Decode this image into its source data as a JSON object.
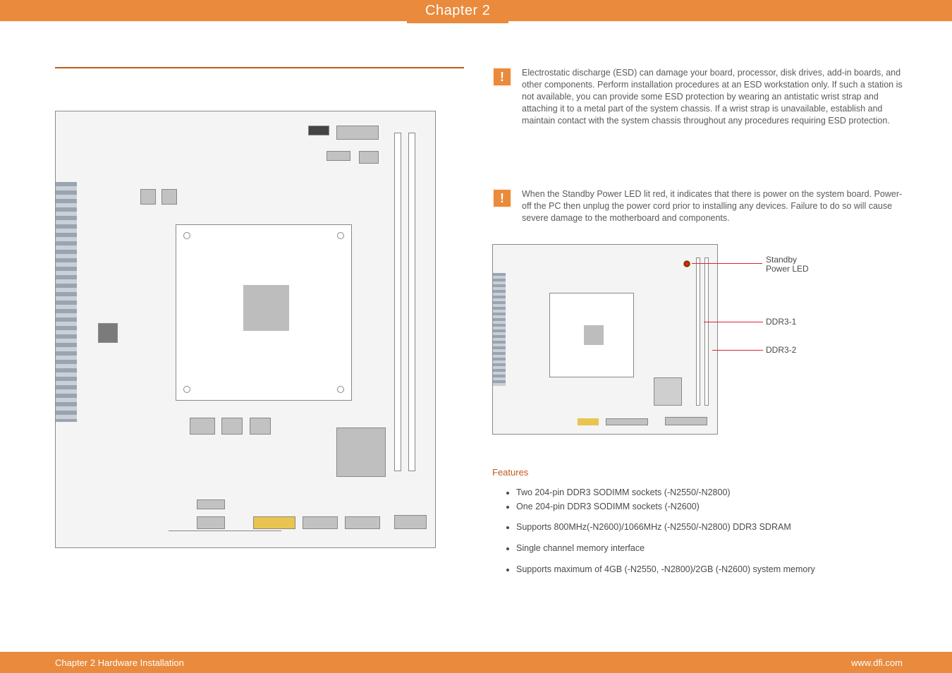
{
  "header": {
    "chapter_tab": "Chapter 2"
  },
  "important": {
    "esd": "Electrostatic discharge (ESD) can damage your board, processor, disk drives, add-in boards, and other components. Perform installation procedures at an ESD workstation only. If such a station is not available, you can provide some ESD protection by wearing an antistatic wrist strap and attaching it to a metal part of the system chassis. If a wrist strap is unavailable, establish and maintain contact with the system chassis throughout any procedures requiring ESD protection.",
    "standby": "When the Standby Power LED lit red, it indicates that there is power on the system board. Power-off the PC then unplug the power cord prior to installing any devices. Failure to do so will cause severe damage to the motherboard and components."
  },
  "board_labels": {
    "standby_led_line1": "Standby",
    "standby_led_line2": "Power LED",
    "ddr3_1": "DDR3-1",
    "ddr3_2": "DDR3-2"
  },
  "features": {
    "title": "Features",
    "items": [
      "Two 204-pin DDR3 SODIMM sockets (-N2550/-N2800)",
      "One 204-pin DDR3 SODIMM sockets (-N2600)",
      "Supports 800MHz(-N2600)/1066MHz (-N2550/-N2800) DDR3 SDRAM",
      "Single channel memory interface",
      "Supports maximum of 4GB (-N2550, -N2800)/2GB (-N2600) system memory"
    ]
  },
  "footer": {
    "left": "Chapter 2 Hardware Installation",
    "right": "www.dfi.com"
  }
}
